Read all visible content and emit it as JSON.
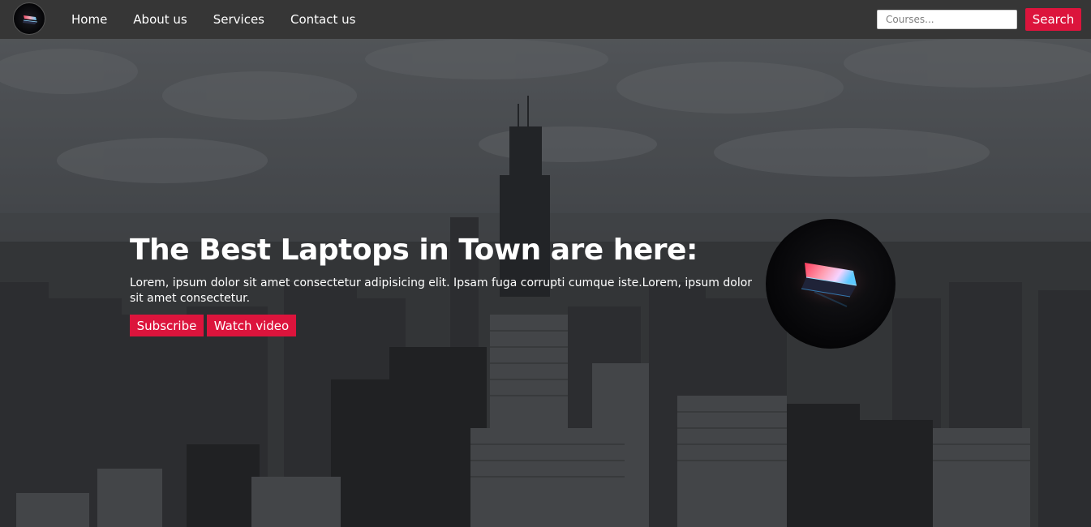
{
  "navbar": {
    "logo_icon": "laptop-logo-icon",
    "links": [
      {
        "label": "Home"
      },
      {
        "label": "About us"
      },
      {
        "label": "Services"
      },
      {
        "label": "Contact us"
      }
    ],
    "search": {
      "placeholder": "Courses...",
      "value": "",
      "button_label": "Search"
    }
  },
  "hero": {
    "title": "The Best Laptops in Town are here:",
    "text": "Lorem, ipsum dolor sit amet consectetur adipisicing elit. Ipsam fuga corrupti cumque iste.Lorem, ipsum dolor sit amet consectetur.",
    "buttons": {
      "subscribe": "Subscribe",
      "watch_video": "Watch video"
    },
    "image_icon": "glowing-laptop-icon",
    "background": "city-skyline-image"
  },
  "colors": {
    "navbar": "#363636",
    "accent": "#dc143c",
    "text": "#ffffff"
  }
}
